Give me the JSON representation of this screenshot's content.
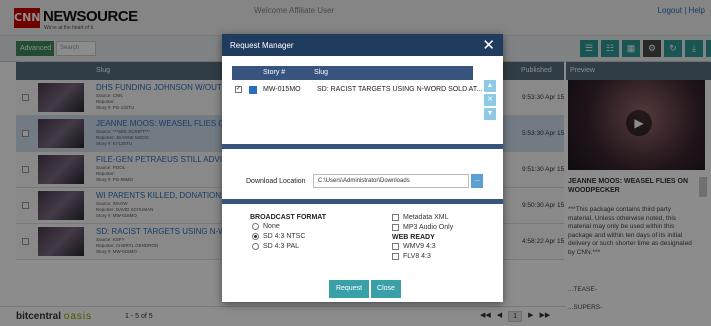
{
  "header": {
    "logo_mark": "CNN",
    "logo_text": "NEWSOURCE",
    "tagline": "We're at the heart of it.",
    "welcome": "Welcome Affiliate User",
    "links": "Logout | Help"
  },
  "toolbar": {
    "advanced_label": "Advanced ▾",
    "search_placeholder": "Search",
    "tools": [
      "☰",
      "☷",
      "▦",
      "⚙",
      "↻",
      "⤓",
      "✎"
    ]
  },
  "grid": {
    "col_slug": "Slug",
    "col_published": "Published",
    "preview_label": "Preview",
    "rows": [
      {
        "title": "DHS FUNDING JOHNSON W/OUT UNCE",
        "source": "Source: CNN",
        "reporter": "Reporter:",
        "story": "Story #: PG-132TU",
        "date": "9:53:30 Apr 15",
        "selected": false
      },
      {
        "title": "JEANNE MOOS: WEASEL FLIES ON W",
        "source": "Source: ***SEE SCRIPT***",
        "reporter": "Reporter: JEANNE MOOS",
        "story": "Story #: KI-136TU",
        "date": "5:53:30 Apr 15",
        "selected": true
      },
      {
        "title": "FILE-GEN PETRAEUS STILL ADVISING",
        "source": "Source: POOL",
        "reporter": "Reporter:",
        "story": "Story #: PG-85MO",
        "date": "9:51:30 Apr 15",
        "selected": false
      },
      {
        "title": "WI PARENTS KILLED, DONATIONS POU",
        "source": "Source: WAOW",
        "reporter": "Reporter: DAVID SCHUMAN",
        "story": "Story #: MW-016MO",
        "date": "9:50:30 Apr 15",
        "selected": false
      },
      {
        "title": "SD: RACIST TARGETS USING N-WORD",
        "source": "Source: KSFY",
        "reporter": "Reporter: CHERYL GENDRON",
        "story": "Story #: MW-015MO",
        "date": "4:58:22 Apr 15",
        "selected": false
      }
    ]
  },
  "preview": {
    "title": "JEANNE MOOS: WEASEL FLIES ON WOODPECKER",
    "description": "***This package contains third party material. Unless otherwise noted, this material may only be used within this package and within ten days of its initial delivery or such shorter time as designated by CNN.***",
    "tease": "...TEASE-",
    "supers": "...SUPERS-"
  },
  "footer": {
    "brand_left": "bitcentral",
    "brand_right": "oasis",
    "record_count": "1 - 5 of 5",
    "page": "1"
  },
  "modal": {
    "title": "Request Manager",
    "close": "✕",
    "col_story": "Story #",
    "col_slug": "Slug",
    "story_number": "MW-015MO",
    "story_slug": "SD: RACIST TARGETS USING N-WORD SOLD AT...",
    "download_label": "Download Location",
    "download_path": "C:\\Users\\Administrator\\Downloads",
    "browse": "...",
    "broadcast_title": "BROADCAST FORMAT",
    "broadcast_options": [
      "None",
      "SD 4:3 NTSC",
      "SD 4:3 PAL"
    ],
    "broadcast_selected": "SD 4:3 NTSC",
    "extra_options": [
      "Metadata XML",
      "MP3 Audio Only"
    ],
    "web_title": "WEB READY",
    "web_options": [
      "WMV9 4:3",
      "FLV8 4:3"
    ],
    "request_button": "Request",
    "close_button": "Close"
  }
}
